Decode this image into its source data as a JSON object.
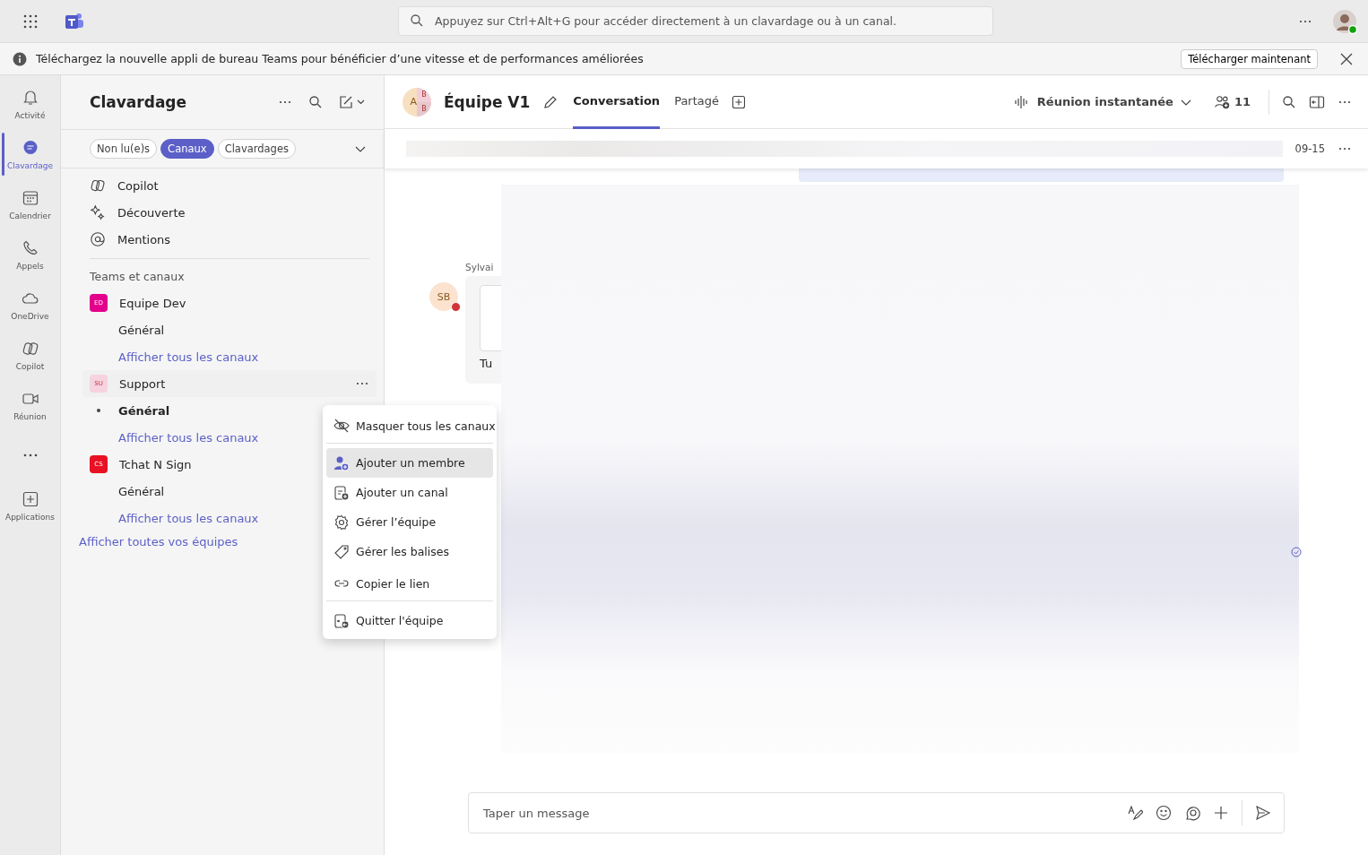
{
  "search": {
    "placeholder": "Appuyez sur Ctrl+Alt+G pour accéder directement à un clavardage ou à un canal."
  },
  "banner": {
    "text": "Téléchargez la nouvelle appli de bureau Teams pour bénéficier d’une vitesse et de performances améliorées",
    "button": "Télécharger maintenant"
  },
  "rail": [
    {
      "label": "Activité",
      "kind": "bell",
      "selected": false
    },
    {
      "label": "Clavardage",
      "kind": "chat",
      "selected": true
    },
    {
      "label": "Calendrier",
      "kind": "calendar",
      "selected": false
    },
    {
      "label": "Appels",
      "kind": "phone",
      "selected": false
    },
    {
      "label": "OneDrive",
      "kind": "cloud",
      "selected": false
    },
    {
      "label": "Copilot",
      "kind": "copilot",
      "selected": false
    },
    {
      "label": "Réunion",
      "kind": "video",
      "selected": false
    },
    {
      "kind": "more",
      "selected": false
    },
    {
      "label": "Applications",
      "kind": "apps",
      "selected": false
    }
  ],
  "sidebar": {
    "title": "Clavardage",
    "filters": [
      {
        "label": "Non lu(e)s",
        "selected": false
      },
      {
        "label": "Canaux",
        "selected": true
      },
      {
        "label": "Clavardages",
        "selected": false
      }
    ],
    "quick": [
      {
        "label": "Copilot",
        "kind": "copilot"
      },
      {
        "label": "Découverte",
        "kind": "sparkle"
      },
      {
        "label": "Mentions",
        "kind": "at"
      }
    ],
    "section": "Teams et canaux",
    "teams": [
      {
        "name": "Equipe Dev",
        "initials": "ED",
        "color": "#e3008c",
        "hovered": false,
        "channels": [
          {
            "name": "Général",
            "selected": false
          }
        ],
        "link": "Afficher tous les canaux"
      },
      {
        "name": "Support",
        "initials": "SU",
        "color": "#f6d3df",
        "hovered": true,
        "channels": [
          {
            "name": "Général",
            "selected": true
          }
        ],
        "link": "Afficher tous les canaux"
      },
      {
        "name": "Tchat N Sign",
        "initials": "CS",
        "color": "#e81123",
        "hovered": false,
        "channels": [
          {
            "name": "Général",
            "selected": false
          }
        ],
        "link": "Afficher tous les canaux"
      }
    ],
    "all_teams": "Afficher toutes vos équipes"
  },
  "menu": [
    {
      "label": "Masquer tous les canaux",
      "kind": "hide",
      "selected": false,
      "divider_after": true
    },
    {
      "label": "Ajouter un membre",
      "kind": "add-person",
      "selected": true,
      "divider_after": false
    },
    {
      "label": "Ajouter un canal",
      "kind": "add-channel",
      "selected": false,
      "divider_after": false
    },
    {
      "label": "Gérer l’équipe",
      "kind": "gear",
      "selected": false,
      "divider_after": false
    },
    {
      "label": "Gérer les balises",
      "kind": "tag",
      "selected": false,
      "divider_after": false
    },
    {
      "label": "Copier le lien",
      "kind": "link",
      "selected": false,
      "divider_after": true
    },
    {
      "label": "Quitter l'équipe",
      "kind": "leave",
      "selected": false,
      "divider_after": false
    }
  ],
  "channel": {
    "avatar_initial": "A",
    "avatar_sub": [
      "B",
      "B"
    ],
    "title": "Équipe V1",
    "tabs": [
      {
        "label": "Conversation",
        "selected": true
      },
      {
        "label": "Partagé",
        "selected": false
      }
    ],
    "meet": "Réunion instantanée",
    "members": "11",
    "date": "09-15"
  },
  "messages": [
    {
      "author": "Sylvai",
      "initials": "SB",
      "preview": "Tu",
      "busy": true
    }
  ],
  "compose": {
    "placeholder": "Taper un message"
  }
}
